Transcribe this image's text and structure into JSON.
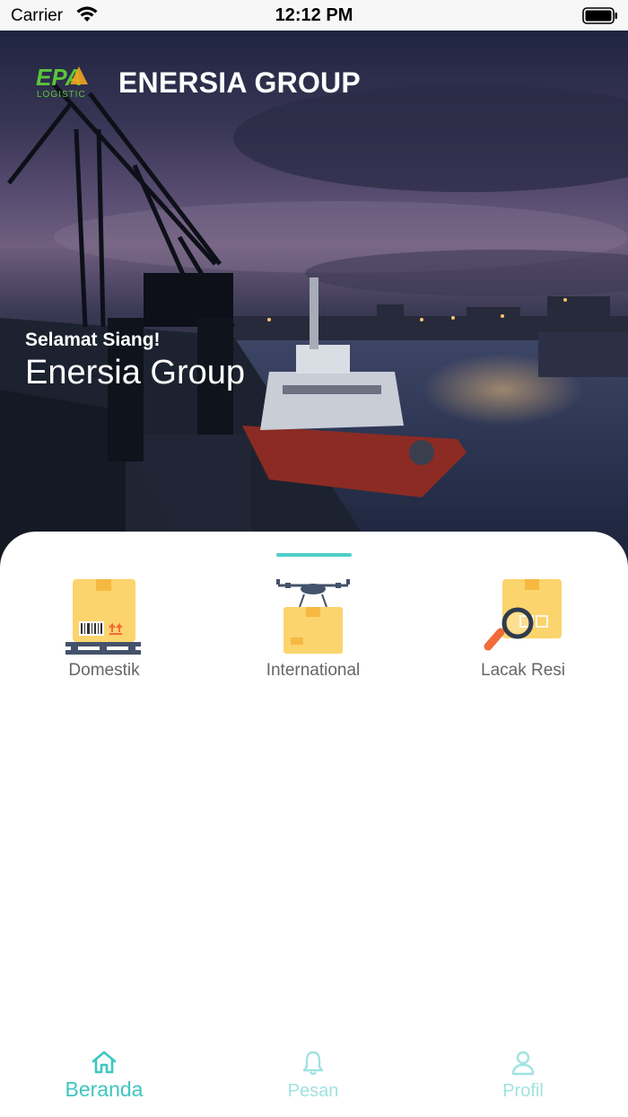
{
  "status_bar": {
    "carrier": "Carrier",
    "time": "12:12 PM"
  },
  "header": {
    "logo_text": "EPA",
    "logo_sub": "LOGISTIC",
    "title": "ENERSIA GROUP"
  },
  "hero": {
    "greeting": "Selamat Siang!",
    "name": "Enersia Group"
  },
  "services": [
    {
      "label": "Domestik",
      "icon": "box-pallet-icon"
    },
    {
      "label": "International",
      "icon": "drone-box-icon"
    },
    {
      "label": "Lacak Resi",
      "icon": "box-search-icon"
    }
  ],
  "tabbar": [
    {
      "label": "Beranda",
      "icon": "home-icon",
      "active": true
    },
    {
      "label": "Pesan",
      "icon": "bell-icon",
      "active": false
    },
    {
      "label": "Profil",
      "icon": "user-icon",
      "active": false
    }
  ],
  "colors": {
    "accent": "#3ec6c0",
    "accent_light": "#9fe3e0",
    "box": "#fbd46d",
    "box_dark": "#f5b942"
  }
}
